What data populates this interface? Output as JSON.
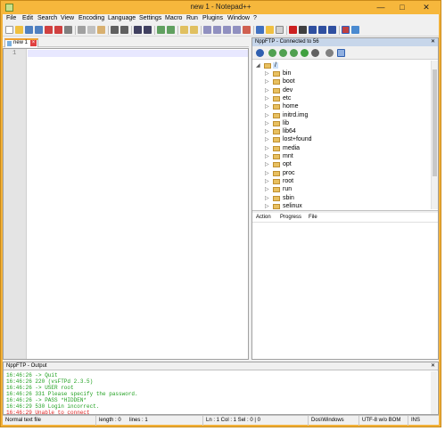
{
  "window": {
    "title": "new  1 - Notepad++",
    "minimize": "—",
    "maximize": "□",
    "close": "✕"
  },
  "menu": [
    "File",
    "Edit",
    "Search",
    "View",
    "Encoding",
    "Language",
    "Settings",
    "Macro",
    "Run",
    "Plugins",
    "Window",
    "?"
  ],
  "tab": {
    "label": "new  1"
  },
  "editor": {
    "line_number": "1"
  },
  "ftp": {
    "title": "NppFTP - Connected to  56",
    "close": "✕",
    "root": "/",
    "folders": [
      "bin",
      "boot",
      "dev",
      "etc",
      "home",
      "initrd.img",
      "lib",
      "lib64",
      "lost+found",
      "media",
      "mnt",
      "opt",
      "proc",
      "root",
      "run",
      "sbin",
      "selinux"
    ],
    "queue_columns": [
      "Action",
      "Progress",
      "File"
    ]
  },
  "output": {
    "title": "NppFTP - Output",
    "close": "✕",
    "lines": [
      {
        "text": "16:46:26  -> Quit",
        "color": "#20a020"
      },
      {
        "text": "16:46:26  220 (vsFTPd 2.3.5)",
        "color": "#20a020"
      },
      {
        "text": "16:46:26  -> USER root",
        "color": "#20a020"
      },
      {
        "text": "16:46:26  331 Please specify the password.",
        "color": "#20a020"
      },
      {
        "text": "16:46:26  -> PASS *HIDDEN*",
        "color": "#20a020"
      },
      {
        "text": "16:46:29  530 Login incorrect.",
        "color": "#20a020"
      },
      {
        "text": "16:46:29  Unable to connect",
        "color": "#e02020"
      }
    ]
  },
  "status": {
    "type": "Normal text file",
    "length": "length : 0",
    "lines": "lines : 1",
    "position": "Ln : 1    Col : 1    Sel : 0 | 0",
    "eol": "Dos\\Windows",
    "encoding": "UTF-8 w/o BOM",
    "mode": "INS"
  },
  "colors": {
    "accent": "#f2b13a",
    "panel_title": "#c7d6ea"
  }
}
